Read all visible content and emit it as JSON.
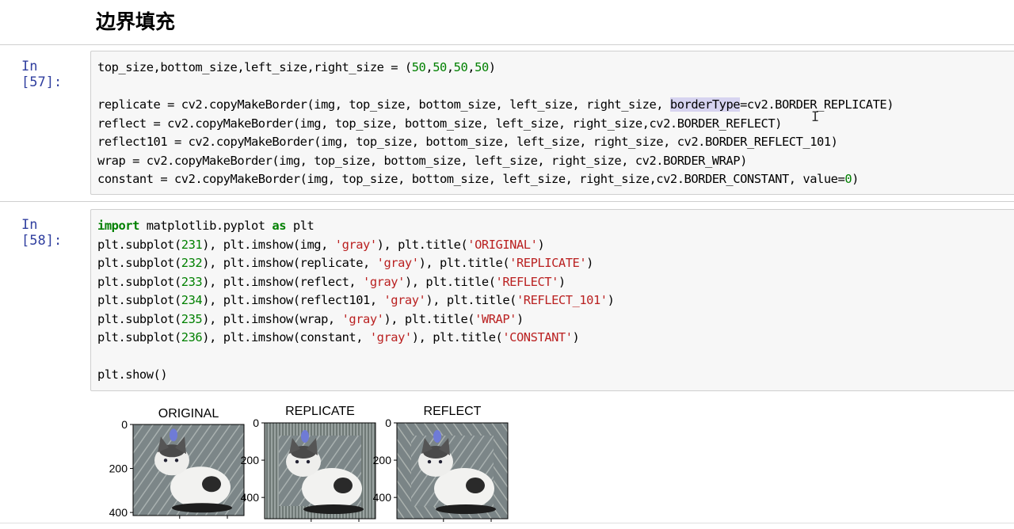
{
  "heading": {
    "title": "边界填充"
  },
  "cell57": {
    "prompt": "In [57]:",
    "lines": [
      [
        {
          "t": "top_size,bottom_size,left_size,right_size = ("
        },
        {
          "t": "50",
          "c": "num"
        },
        {
          "t": ","
        },
        {
          "t": "50",
          "c": "num"
        },
        {
          "t": ","
        },
        {
          "t": "50",
          "c": "num"
        },
        {
          "t": ","
        },
        {
          "t": "50",
          "c": "num"
        },
        {
          "t": ")"
        }
      ],
      [],
      [
        {
          "t": "replicate = cv2.copyMakeBorder(img, top_size, bottom_size, left_size, right_size, "
        },
        {
          "t": "borderType",
          "c": "hl"
        },
        {
          "t": "=cv2.BORDER_REPLICATE)"
        }
      ],
      [
        {
          "t": "reflect = cv2.copyMakeBorder(img, top_size, bottom_size, left_size, right_size,cv2.BORDER_REFLECT)"
        }
      ],
      [
        {
          "t": "reflect101 = cv2.copyMakeBorder(img, top_size, bottom_size, left_size, right_size, cv2.BORDER_REFLECT_101)"
        }
      ],
      [
        {
          "t": "wrap = cv2.copyMakeBorder(img, top_size, bottom_size, left_size, right_size, cv2.BORDER_WRAP)"
        }
      ],
      [
        {
          "t": "constant = cv2.copyMakeBorder(img, top_size, bottom_size, left_size, right_size,cv2.BORDER_CONSTANT, value="
        },
        {
          "t": "0",
          "c": "num"
        },
        {
          "t": ")"
        }
      ]
    ]
  },
  "cell58": {
    "prompt": "In [58]:",
    "lines": [
      [
        {
          "t": "import",
          "c": "kw"
        },
        {
          "t": " matplotlib.pyplot "
        },
        {
          "t": "as",
          "c": "kw"
        },
        {
          "t": " plt"
        }
      ],
      [
        {
          "t": "plt.subplot("
        },
        {
          "t": "231",
          "c": "num"
        },
        {
          "t": "), plt.imshow(img, "
        },
        {
          "t": "'gray'",
          "c": "str"
        },
        {
          "t": "), plt.title("
        },
        {
          "t": "'ORIGINAL'",
          "c": "str"
        },
        {
          "t": ")"
        }
      ],
      [
        {
          "t": "plt.subplot("
        },
        {
          "t": "232",
          "c": "num"
        },
        {
          "t": "), plt.imshow(replicate, "
        },
        {
          "t": "'gray'",
          "c": "str"
        },
        {
          "t": "), plt.title("
        },
        {
          "t": "'REPLICATE'",
          "c": "str"
        },
        {
          "t": ")"
        }
      ],
      [
        {
          "t": "plt.subplot("
        },
        {
          "t": "233",
          "c": "num"
        },
        {
          "t": "), plt.imshow(reflect, "
        },
        {
          "t": "'gray'",
          "c": "str"
        },
        {
          "t": "), plt.title("
        },
        {
          "t": "'REFLECT'",
          "c": "str"
        },
        {
          "t": ")"
        }
      ],
      [
        {
          "t": "plt.subplot("
        },
        {
          "t": "234",
          "c": "num"
        },
        {
          "t": "), plt.imshow(reflect101, "
        },
        {
          "t": "'gray'",
          "c": "str"
        },
        {
          "t": "), plt.title("
        },
        {
          "t": "'REFLECT_101'",
          "c": "str"
        },
        {
          "t": ")"
        }
      ],
      [
        {
          "t": "plt.subplot("
        },
        {
          "t": "235",
          "c": "num"
        },
        {
          "t": "), plt.imshow(wrap, "
        },
        {
          "t": "'gray'",
          "c": "str"
        },
        {
          "t": "), plt.title("
        },
        {
          "t": "'WRAP'",
          "c": "str"
        },
        {
          "t": ")"
        }
      ],
      [
        {
          "t": "plt.subplot("
        },
        {
          "t": "236",
          "c": "num"
        },
        {
          "t": "), plt.imshow(constant, "
        },
        {
          "t": "'gray'",
          "c": "str"
        },
        {
          "t": "), plt.title("
        },
        {
          "t": "'CONSTANT'",
          "c": "str"
        },
        {
          "t": ")"
        }
      ],
      [],
      [
        {
          "t": "plt.show()"
        }
      ]
    ]
  },
  "output": {
    "plots": [
      {
        "title": "ORIGINAL",
        "yticks": [
          "0",
          "200",
          "400"
        ]
      },
      {
        "title": "REPLICATE",
        "yticks": [
          "0",
          "200",
          "400"
        ]
      },
      {
        "title": "REFLECT",
        "yticks": [
          "0",
          "200",
          "400"
        ]
      }
    ]
  },
  "colors": {
    "prompt": "#303f9f",
    "keyword": "#008000",
    "string": "#ba2121",
    "cell_bg": "#f7f7f7"
  }
}
